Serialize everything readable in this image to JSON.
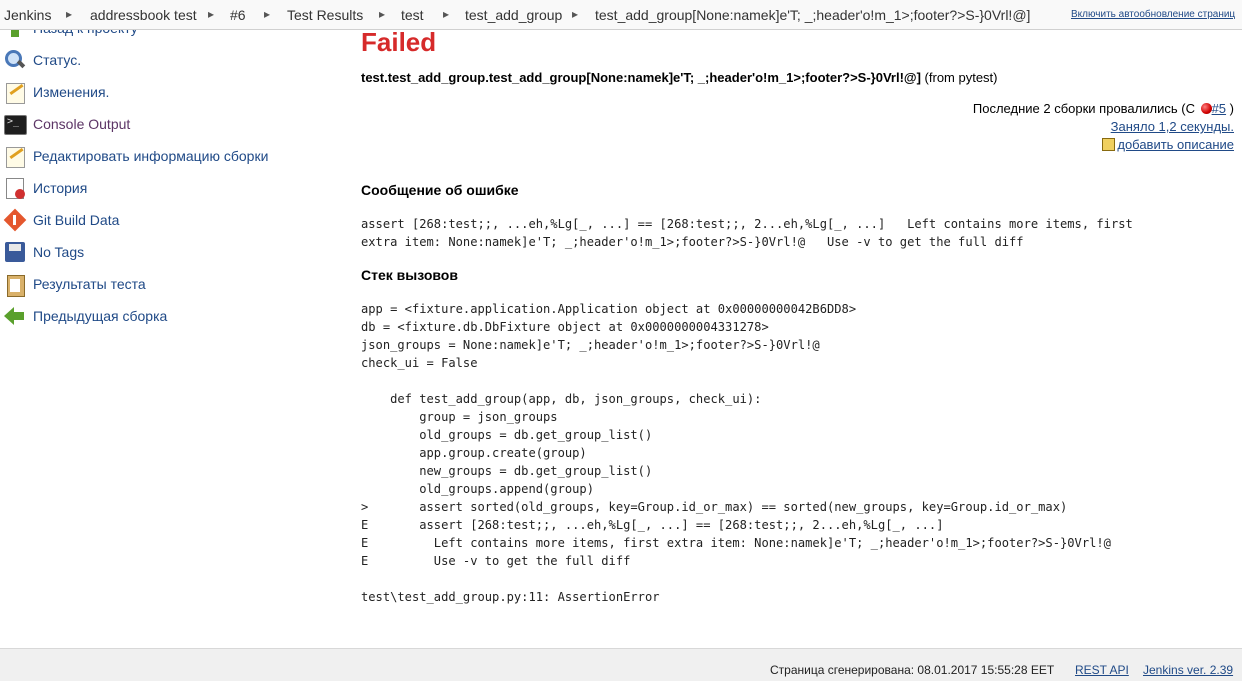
{
  "breadcrumbs": [
    "Jenkins",
    "addressbook test",
    "#6",
    "Test Results",
    "test",
    "test_add_group",
    "test_add_group[None:namek]e'T; _;header'o!m_1>;footer?>S-}0Vrl!@]"
  ],
  "breadcrumb_separator": "▸",
  "autorefresh_label": "Включить автообновление страниц",
  "sidebar": {
    "items": [
      {
        "label": "Назад к проекту",
        "icon": "up-arrow-icon"
      },
      {
        "label": "Статус.",
        "icon": "search-icon"
      },
      {
        "label": "Изменения.",
        "icon": "notepad-icon"
      },
      {
        "label": "Console Output",
        "icon": "terminal-icon"
      },
      {
        "label": "Редактировать информацию сборки",
        "icon": "notepad-icon"
      },
      {
        "label": "История",
        "icon": "history-icon"
      },
      {
        "label": "Git Build Data",
        "icon": "git-icon"
      },
      {
        "label": "No Tags",
        "icon": "floppy-icon"
      },
      {
        "label": "Результаты теста",
        "icon": "clipboard-icon"
      },
      {
        "label": "Предыдущая сборка",
        "icon": "left-arrow-icon"
      }
    ]
  },
  "main": {
    "status": "Failed",
    "status_color": "#d62a2a",
    "test_name": "test.test_add_group.test_add_group[None:namek]e'T; _;header'o!m_1>;footer?>S-}0Vrl!@]",
    "test_source": "(from pytest)",
    "failed_since_prefix": "Последние 2 сборки провалились (С ",
    "failed_since_build": "#5",
    "failed_since_suffix": " )",
    "duration": "Заняло 1,2 секунды.",
    "add_description": "добавить описание",
    "error_heading": "Сообщение об ошибке",
    "error_message": "assert [268:test;;, ...eh,%Lg[_, ...] == [268:test;;, 2...eh,%Lg[_, ...]   Left contains more items, first\nextra item: None:namek]e'T; _;header'o!m_1>;footer?>S-}0Vrl!@   Use -v to get the full diff",
    "stack_heading": "Стек вызовов",
    "stack_trace": "app = <fixture.application.Application object at 0x00000000042B6DD8>\ndb = <fixture.db.DbFixture object at 0x0000000004331278>\njson_groups = None:namek]e'T; _;header'o!m_1>;footer?>S-}0Vrl!@\ncheck_ui = False\n\n    def test_add_group(app, db, json_groups, check_ui):\n        group = json_groups\n        old_groups = db.get_group_list()\n        app.group.create(group)\n        new_groups = db.get_group_list()\n        old_groups.append(group)\n>       assert sorted(old_groups, key=Group.id_or_max) == sorted(new_groups, key=Group.id_or_max)\nE       assert [268:test;;, ...eh,%Lg[_, ...] == [268:test;;, 2...eh,%Lg[_, ...]\nE         Left contains more items, first extra item: None:namek]e'T; _;header'o!m_1>;footer?>S-}0Vrl!@\nE         Use -v to get the full diff\n\ntest\\test_add_group.py:11: AssertionError"
  },
  "footer": {
    "generated": "Страница сгенерирована: 08.01.2017 15:55:28 EET",
    "rest_api": "REST API",
    "version": "Jenkins ver. 2.39"
  }
}
